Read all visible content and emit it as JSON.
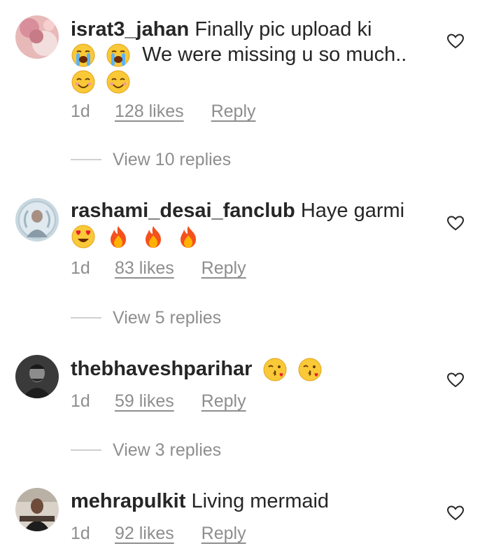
{
  "comments": [
    {
      "username": "israt3_jahan",
      "text_line1": "Finally pic upload  ki",
      "text_line2": "We were missing u so much..",
      "time": "1d",
      "likes": "128 likes",
      "reply": "Reply",
      "view_replies": "View 10 replies",
      "emojis": [
        "loudly-crying-face",
        "loudly-crying-face",
        "smiling-face",
        "smiling-face"
      ]
    },
    {
      "username": "rashami_desai_fanclub",
      "text_line1": "Haye garmi",
      "time": "1d",
      "likes": "83 likes",
      "reply": "Reply",
      "view_replies": "View 5 replies",
      "emojis": [
        "heart-eyes-face",
        "fire",
        "fire",
        "fire"
      ]
    },
    {
      "username": "thebhaveshparihar",
      "text_line1": "",
      "time": "1d",
      "likes": "59 likes",
      "reply": "Reply",
      "view_replies": "View 3 replies",
      "emojis": [
        "kissing-heart-face",
        "kissing-heart-face"
      ]
    },
    {
      "username": "mehrapulkit",
      "text_line1": "Living mermaid",
      "time": "1d",
      "likes": "92 likes",
      "reply": "Reply",
      "emojis": []
    }
  ],
  "icons": {
    "like": "heart-outline-icon"
  },
  "colors": {
    "text": "#262626",
    "meta": "#8e8e8e",
    "divider": "#d0d0d0"
  }
}
